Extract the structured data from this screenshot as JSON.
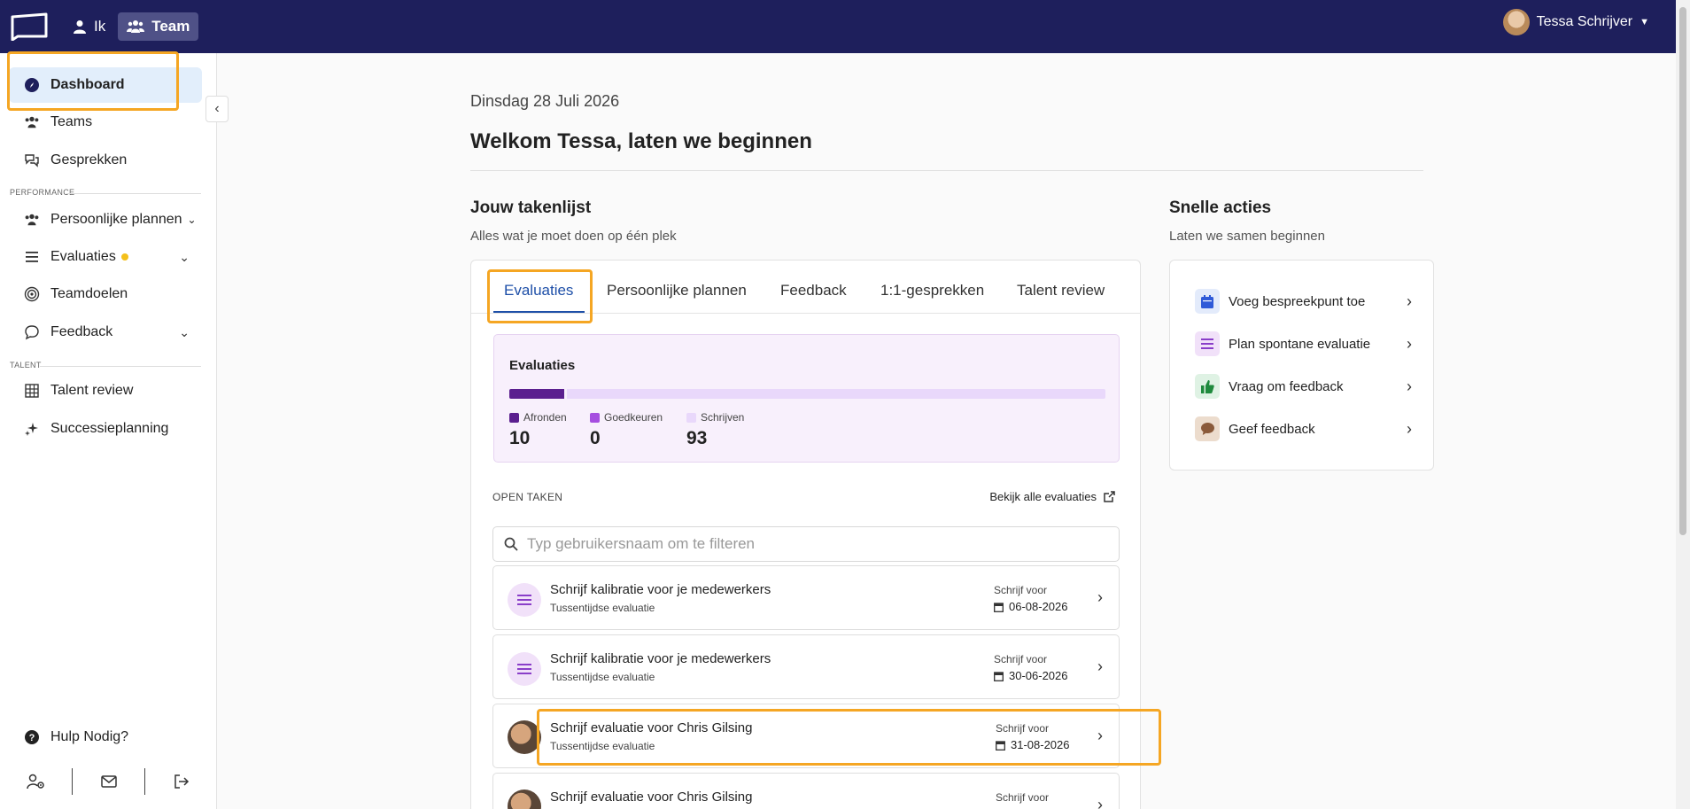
{
  "topbar": {
    "nav": [
      {
        "label": "Ik"
      },
      {
        "label": "Team"
      }
    ],
    "user_name": "Tessa Schrijver"
  },
  "sidebar": {
    "items": [
      {
        "label": "Dashboard"
      },
      {
        "label": "Teams"
      },
      {
        "label": "Gesprekken"
      }
    ],
    "section_performance": "PERFORMANCE",
    "performance_items": [
      {
        "label": "Persoonlijke plannen"
      },
      {
        "label": "Evaluaties"
      },
      {
        "label": "Teamdoelen"
      },
      {
        "label": "Feedback"
      }
    ],
    "section_talent": "TALENT",
    "talent_items": [
      {
        "label": "Talent review"
      },
      {
        "label": "Successieplanning"
      }
    ],
    "help_label": "Hulp Nodig?"
  },
  "main": {
    "date": "Dinsdag 28 Juli 2026",
    "welcome": "Welkom Tessa, laten we beginnen",
    "tasklist": {
      "title": "Jouw takenlijst",
      "subtitle": "Alles wat je moet doen op één plek",
      "tabs": [
        {
          "label": "Evaluaties"
        },
        {
          "label": "Persoonlijke plannen"
        },
        {
          "label": "Feedback"
        },
        {
          "label": "1:1-gesprekken"
        },
        {
          "label": "Talent review"
        }
      ],
      "evaluations": {
        "title": "Evaluaties",
        "legend": [
          {
            "label": "Afronden",
            "value": "10",
            "color": "#5b1f8f"
          },
          {
            "label": "Goedkeuren",
            "value": "0",
            "color": "#a64ee0"
          },
          {
            "label": "Schrijven",
            "value": "93",
            "color": "#e9d8fb"
          }
        ],
        "progress_fraction_afronden": 0.097
      },
      "open_tasks_label": "OPEN TAKEN",
      "view_all_label": "Bekijk alle evaluaties",
      "search_placeholder": "Typ gebruikersnaam om te filteren",
      "tasks": [
        {
          "title": "Schrijf kalibratie voor je medewerkers",
          "subtitle": "Tussentijdse evaluatie",
          "due_label": "Schrijf voor",
          "due_date": "06-08-2026"
        },
        {
          "title": "Schrijf kalibratie voor je medewerkers",
          "subtitle": "Tussentijdse evaluatie",
          "due_label": "Schrijf voor",
          "due_date": "30-06-2026"
        },
        {
          "title": "Schrijf evaluatie voor Chris Gilsing",
          "subtitle": "Tussentijdse evaluatie",
          "due_label": "Schrijf voor",
          "due_date": "31-08-2026"
        },
        {
          "title": "Schrijf evaluatie voor Chris Gilsing",
          "subtitle": "",
          "due_label": "Schrijf voor",
          "due_date": ""
        }
      ]
    },
    "quick_actions": {
      "title": "Snelle acties",
      "subtitle": "Laten we samen beginnen",
      "items": [
        {
          "label": "Voeg bespreekpunt toe",
          "icon": "calendar-icon",
          "color": "#2f5ad8"
        },
        {
          "label": "Plan spontane evaluatie",
          "icon": "list-icon",
          "color": "#8a3ec9"
        },
        {
          "label": "Vraag om feedback",
          "icon": "thumbs-up-icon",
          "color": "#1f8a3d"
        },
        {
          "label": "Geef feedback",
          "icon": "speech-bubble-icon",
          "color": "#8a5a3a"
        }
      ]
    }
  }
}
